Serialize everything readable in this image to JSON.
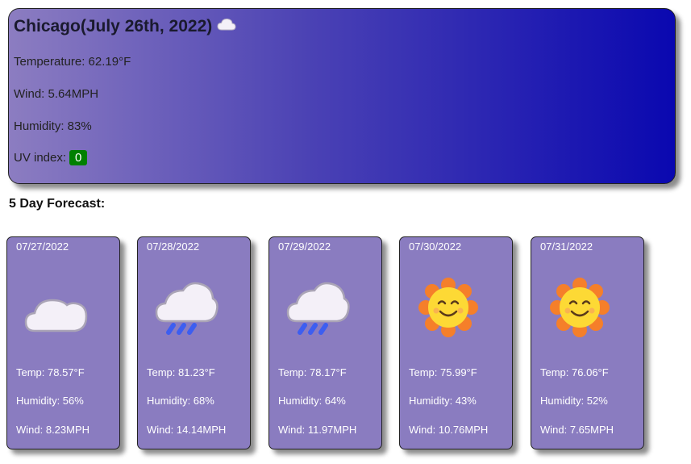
{
  "current": {
    "title": "Chicago(July 26th, 2022)",
    "icon": "cloud-icon",
    "temperature": "Temperature: 62.19°F",
    "wind": "Wind: 5.64MPH",
    "humidity": "Humidity: 83%",
    "uv_label": "UV index:",
    "uv_value": "0",
    "uv_color": "#008000"
  },
  "forecast_heading": "5 Day Forecast:",
  "forecast": [
    {
      "date": "07/27/2022",
      "icon": "cloud-icon",
      "temp": "Temp: 78.57°F",
      "humidity": "Humidity: 56%",
      "wind": "Wind: 8.23MPH"
    },
    {
      "date": "07/28/2022",
      "icon": "rain-cloud-icon",
      "temp": "Temp: 81.23°F",
      "humidity": "Humidity: 68%",
      "wind": "Wind: 14.14MPH"
    },
    {
      "date": "07/29/2022",
      "icon": "rain-cloud-icon",
      "temp": "Temp: 78.17°F",
      "humidity": "Humidity: 64%",
      "wind": "Wind: 11.97MPH"
    },
    {
      "date": "07/30/2022",
      "icon": "smiling-sun-icon",
      "temp": "Temp: 75.99°F",
      "humidity": "Humidity: 43%",
      "wind": "Wind: 10.76MPH"
    },
    {
      "date": "07/31/2022",
      "icon": "smiling-sun-icon",
      "temp": "Temp: 76.06°F",
      "humidity": "Humidity: 52%",
      "wind": "Wind: 7.65MPH"
    }
  ]
}
